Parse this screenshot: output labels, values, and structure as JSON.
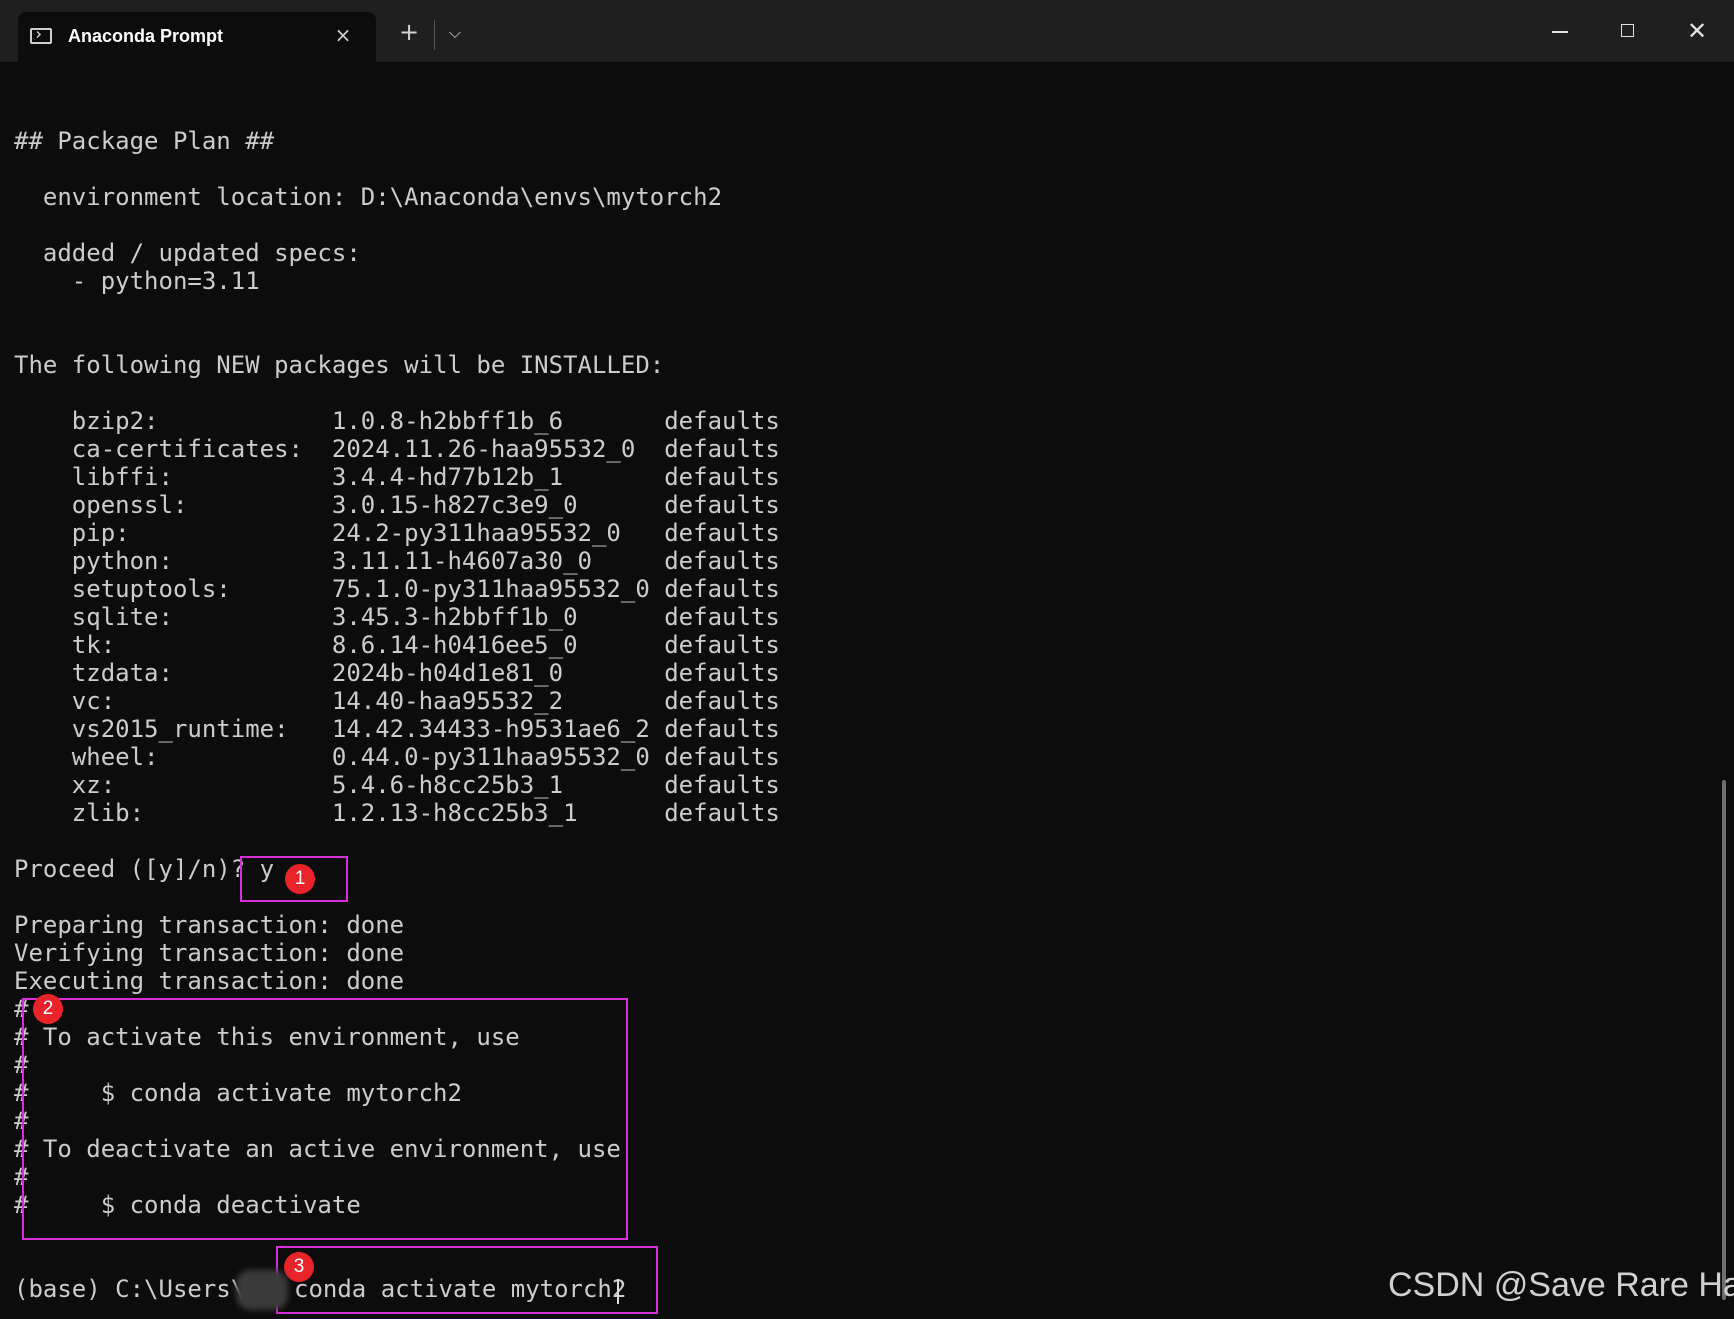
{
  "window": {
    "tab_title": "Anaconda Prompt",
    "tab_close_icon": "×",
    "new_tab_icon": "+",
    "dropdown_icon": "⌵",
    "close_icon": "✕"
  },
  "terminal": {
    "lines": [
      "## Package Plan ##",
      "  environment location: D:\\Anaconda\\envs\\mytorch2",
      "  added / updated specs:",
      "    - python=3.11",
      "The following NEW packages will be INSTALLED:",
      "    bzip2:            1.0.8-h2bbff1b_6       defaults",
      "    ca-certificates:  2024.11.26-haa95532_0  defaults",
      "    libffi:           3.4.4-hd77b12b_1       defaults",
      "    openssl:          3.0.15-h827c3e9_0      defaults",
      "    pip:              24.2-py311haa95532_0   defaults",
      "    python:           3.11.11-h4607a30_0     defaults",
      "    setuptools:       75.1.0-py311haa95532_0 defaults",
      "    sqlite:           3.45.3-h2bbff1b_0      defaults",
      "    tk:               8.6.14-h0416ee5_0      defaults",
      "    tzdata:           2024b-h04d1e81_0       defaults",
      "    vc:               14.40-haa95532_2       defaults",
      "    vs2015_runtime:   14.42.34433-h9531ae6_2 defaults",
      "    wheel:            0.44.0-py311haa95532_0 defaults",
      "    xz:               5.4.6-h8cc25b3_1       defaults",
      "    zlib:             1.2.13-h8cc25b3_1      defaults",
      "Proceed ([y]/n)? y",
      "Preparing transaction: done",
      "Verifying transaction: done",
      "Executing transaction: done",
      "#",
      "# To activate this environment, use",
      "#",
      "#     $ conda activate mytorch2",
      "#",
      "# To deactivate an active environment, use",
      "#",
      "#     $ conda deactivate",
      "(base) C:\\Users\\",
      "conda activate mytorch2"
    ]
  },
  "annotations": {
    "badge_1": "1",
    "badge_2": "2",
    "badge_3": "3",
    "box_color": "#d72fd7",
    "badge_color": "#e8232a"
  },
  "watermark": "CSDN @Save Rare Hair"
}
